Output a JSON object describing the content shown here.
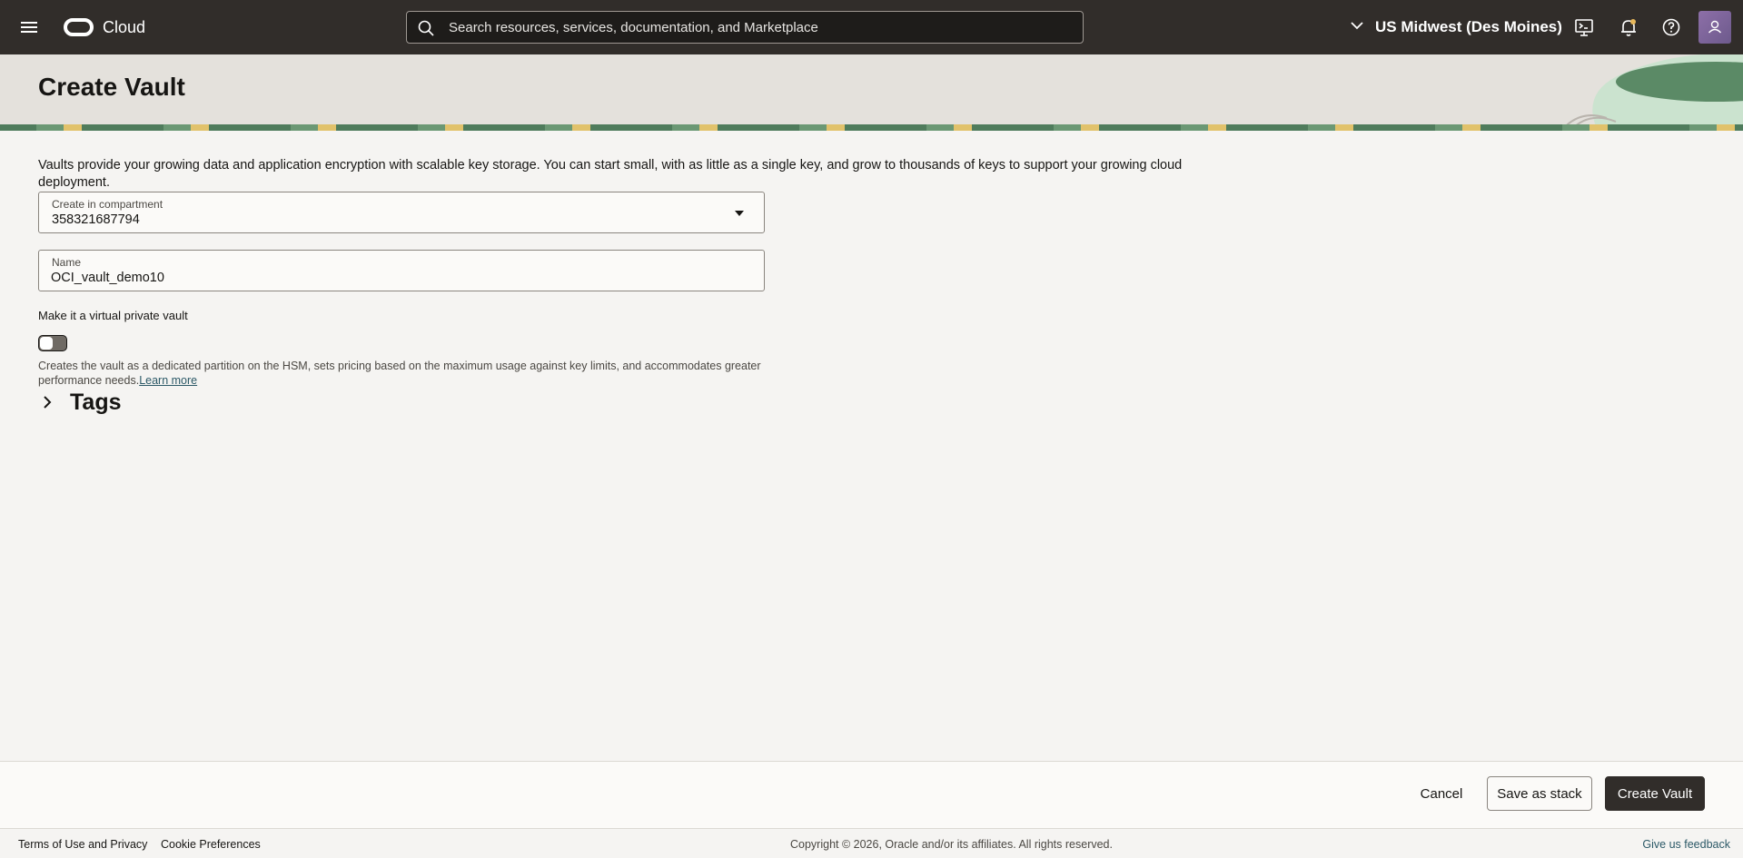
{
  "topbar": {
    "brand": "Cloud",
    "search_placeholder": "Search resources, services, documentation, and Marketplace",
    "region": "US Midwest (Des Moines)",
    "icons": [
      "menu-icon",
      "search-icon",
      "chevron-down-icon",
      "cloud-shell-icon",
      "bell-icon",
      "help-icon",
      "user-icon"
    ]
  },
  "page": {
    "title": "Create Vault",
    "intro": "Vaults provide your growing data and application encryption with scalable key storage. You can start small, with as little as a single key, and grow to thousands of keys to support your growing cloud deployment."
  },
  "form": {
    "compartment": {
      "label": "Create in compartment",
      "value": "358321687794"
    },
    "name": {
      "label": "Name",
      "value": "OCI_vault_demo10"
    },
    "virtual_private": {
      "label": "Make it a virtual private vault",
      "enabled": false,
      "help": "Creates the vault as a dedicated partition on the HSM, sets pricing based on the maximum usage against key limits, and accommodates greater performance needs.",
      "learn_more": "Learn more"
    },
    "tags": {
      "title": "Tags"
    }
  },
  "actions": {
    "cancel": "Cancel",
    "save_stack": "Save as stack",
    "create": "Create Vault"
  },
  "footer": {
    "terms": "Terms of Use and Privacy",
    "cookies": "Cookie Preferences",
    "copyright": "Copyright © 2026, Oracle and/or its affiliates. All rights reserved.",
    "feedback": "Give us feedback"
  },
  "colors": {
    "topbar": "#312d2a",
    "banner": "#e4e1dc",
    "accent_link": "#2c5967",
    "primary_button": "#312d2a"
  }
}
